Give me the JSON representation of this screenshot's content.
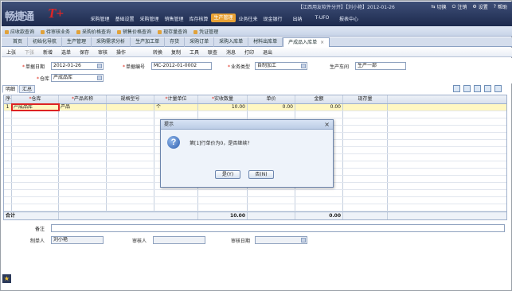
{
  "top": {
    "logo_text": "畅捷通",
    "logo_mark": "T+",
    "info": "【江西用友软件分开】【刘小艳】2012-01-26",
    "actions": [
      "切换",
      "注销",
      "设置",
      "帮助"
    ],
    "nav": [
      "采购管理",
      "基础设置",
      "采购管理",
      "销售管理",
      "库存核算",
      "生产管理",
      "业务往来",
      "现金银行",
      "出纳",
      "T-UFO",
      "报表中心"
    ],
    "nav_active_index": 5
  },
  "quickbar": [
    "应收款查询",
    "待审核业务",
    "采购价格查询",
    "销售价格查询",
    "现存量查询",
    "凭证管理"
  ],
  "tabs": [
    "首页",
    "初始化导航",
    "生产管理",
    "采购需求分析",
    "生产加工单",
    "存货",
    "采购订单",
    "采购入库单",
    "材料出库单",
    "产成品入库单"
  ],
  "active_tab_label": "产成品入库单",
  "toolbar": [
    "上张",
    "下张",
    "新增",
    "选单",
    "保存",
    "审核",
    "操作",
    "",
    "转换",
    "复制",
    "工具",
    "联查",
    "消息",
    "打印",
    "退出"
  ],
  "form": {
    "date_label": "单据日期",
    "date_value": "2012-01-26",
    "code_label": "单据编号",
    "code_value": "MC-2012-01-0002",
    "biz_type_label": "业务类型",
    "biz_type_value": "自制加工",
    "workshop_label": "生产车间",
    "workshop_value": "生产一部",
    "warehouse_label": "仓库",
    "warehouse_value": "产成品库"
  },
  "subtabs": [
    "明细",
    "汇总"
  ],
  "grid": {
    "headers": [
      "序号",
      "仓库",
      "产品名称",
      "规格型号",
      "计量单位",
      "实收数量",
      "单价",
      "金额",
      "现存量"
    ],
    "required_columns": [
      1,
      2,
      4,
      5
    ],
    "rows": [
      [
        "1",
        "产成品库",
        "产品",
        "",
        "个",
        "10.00",
        "0.00",
        "0.00",
        ""
      ]
    ],
    "empty_rows": 15,
    "total_label": "合计",
    "total_qty": "10.00",
    "total_amount": "0.00"
  },
  "footer": {
    "remark_label": "备注",
    "maker_label": "制单人",
    "maker_value": "刘小艳",
    "auditor_label": "审核人",
    "audit_date_label": "审核日期"
  },
  "dialog": {
    "title": "提示",
    "close": "×",
    "icon_glyph": "?",
    "message": "第[1]行单价为0，是否继续?",
    "yes_label": "是(Y)",
    "no_label": "否(N)"
  },
  "status_icon": "★"
}
